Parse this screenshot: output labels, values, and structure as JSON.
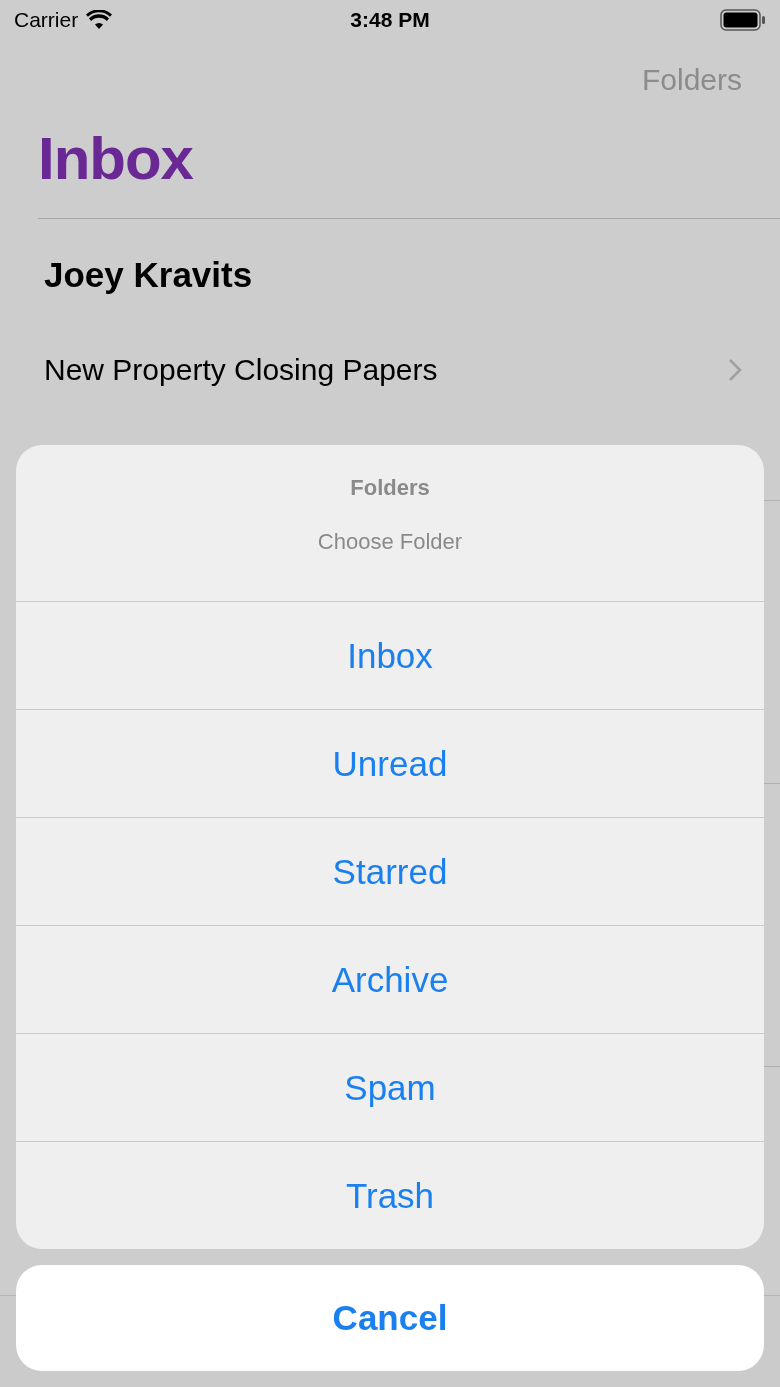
{
  "status_bar": {
    "carrier": "Carrier",
    "time": "3:48 PM"
  },
  "nav": {
    "right_button": "Folders",
    "title": "Inbox"
  },
  "messages": [
    {
      "sender": "Joey Kravits",
      "subject": "New Property Closing Papers"
    }
  ],
  "action_sheet": {
    "title": "Folders",
    "message": "Choose Folder",
    "actions": [
      "Inbox",
      "Unread",
      "Starred",
      "Archive",
      "Spam",
      "Trash"
    ],
    "cancel": "Cancel"
  }
}
